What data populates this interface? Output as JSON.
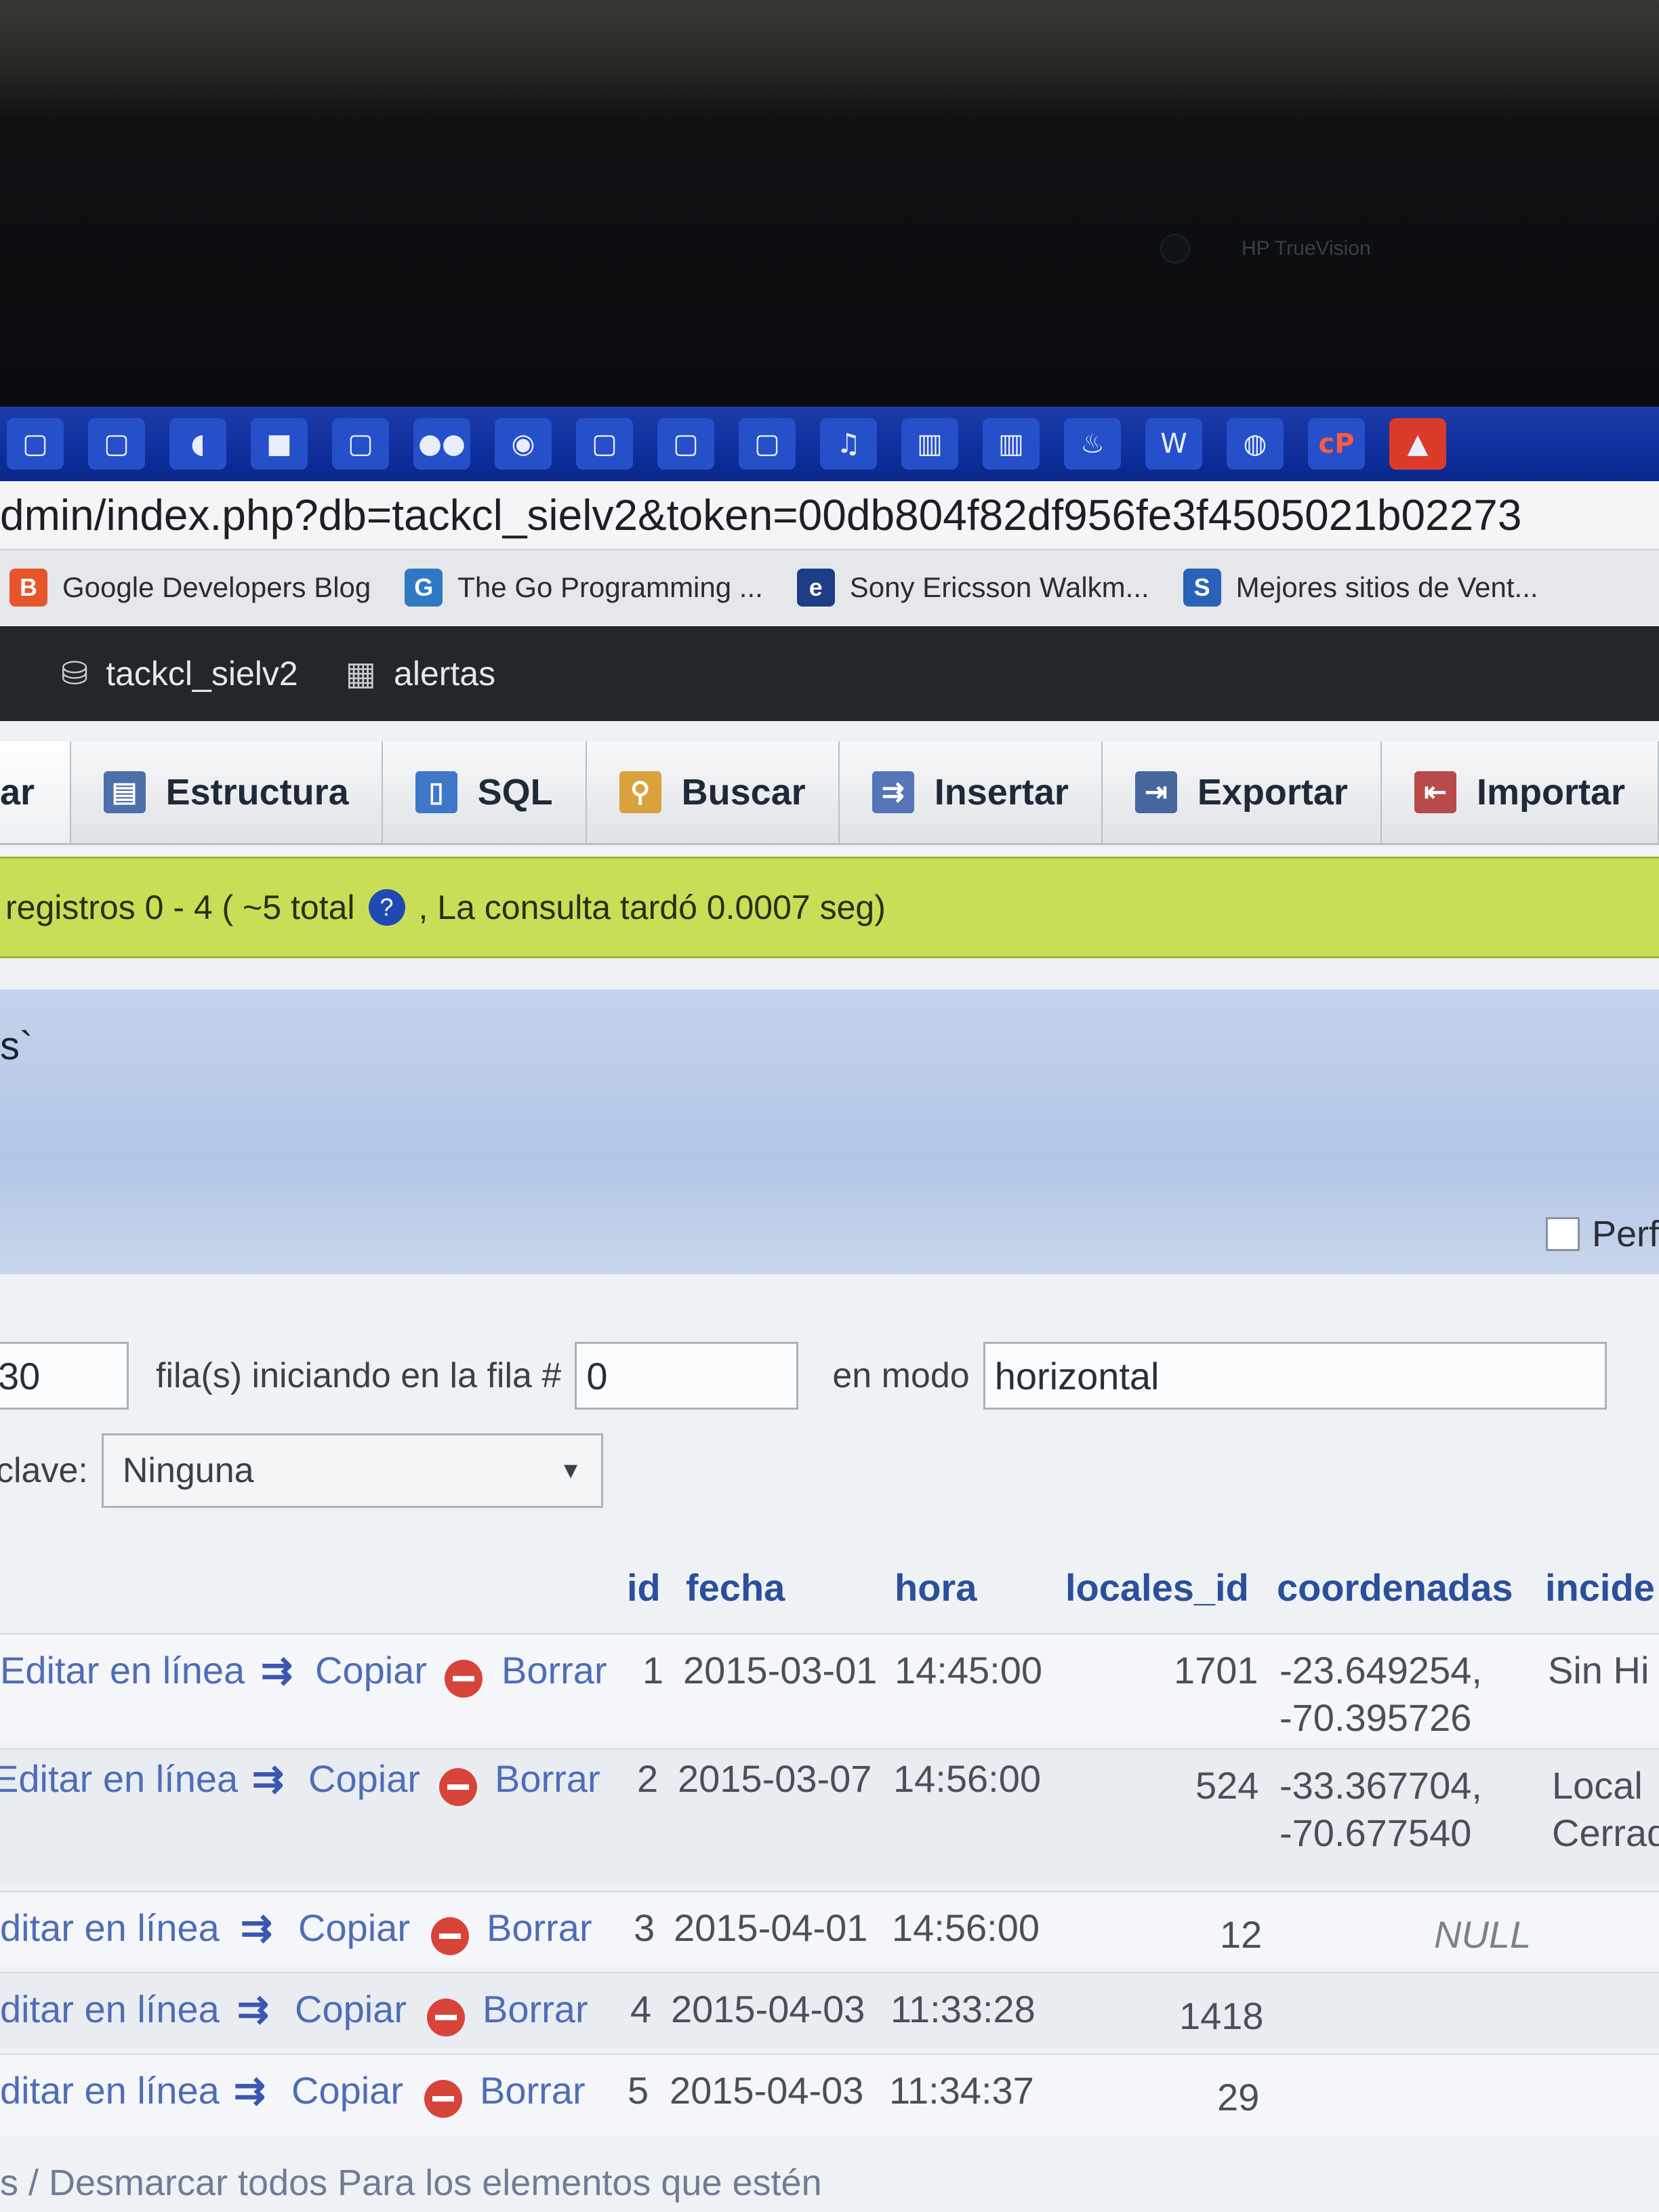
{
  "bezel": {
    "camera_label": "HP TrueVision"
  },
  "taskbar": {
    "icons": [
      "file-icon",
      "file-icon",
      "chat-icon",
      "dark-square-icon",
      "file-icon",
      "people-icon",
      "chrome-icon",
      "file-icon",
      "file-icon",
      "file-icon",
      "music-icon",
      "window-icon",
      "window-icon",
      "flame-icon",
      "w-icon",
      "disk-icon",
      "cp-icon",
      "alert-icon",
      "file-icon"
    ]
  },
  "address_bar": {
    "url": "dmin/index.php?db=tackcl_sielv2&token=00db804f82df956fe3f4505021b02273"
  },
  "bookmarks": [
    {
      "label": "Google Developers Blog",
      "icon": "blogger-icon",
      "color": "#e8552b"
    },
    {
      "label": "The Go Programming ...",
      "icon": "gopher-icon",
      "color": "#2f78c4"
    },
    {
      "label": "Sony Ericsson Walkm...",
      "icon": "e-icon",
      "color": "#1d3d86"
    },
    {
      "label": "Mejores sitios de Vent...",
      "icon": "s-icon",
      "color": "#2a62b8"
    }
  ],
  "breadcrumb": {
    "database": "tackcl_sielv2",
    "table": "alertas"
  },
  "tabs": [
    {
      "label": "ar",
      "icon": ""
    },
    {
      "label": "Estructura",
      "icon": "structure-icon"
    },
    {
      "label": "SQL",
      "icon": "sql-icon"
    },
    {
      "label": "Buscar",
      "icon": "search-icon"
    },
    {
      "label": "Insertar",
      "icon": "insert-icon"
    },
    {
      "label": "Exportar",
      "icon": "export-icon"
    },
    {
      "label": "Importar",
      "icon": "import-icon"
    }
  ],
  "status": {
    "text_before": "registros 0 - 4 ( ~5 total",
    "text_after": ", La consulta tardó 0.0007 seg)"
  },
  "banner": {
    "text": "s`"
  },
  "profile": {
    "label": "Perf"
  },
  "controls": {
    "rows_value": "30",
    "rows_label": "fila(s) iniciando en la fila #",
    "start_value": "0",
    "mode_label": "en modo",
    "mode_value": "horizontal",
    "key_label": "clave:",
    "key_value": "Ninguna"
  },
  "table": {
    "columns": [
      "id",
      "fecha",
      "hora",
      "locales_id",
      "coordenadas",
      "incide"
    ],
    "actions": {
      "edit": "Editar en línea",
      "copy": "Copiar",
      "delete": "Borrar"
    },
    "rows": [
      {
        "edit": "Editar en línea",
        "id": "1",
        "fecha": "2015-03-01",
        "hora": "14:45:00",
        "locales_id": "1701",
        "coord1": "-23.649254,",
        "coord2": "-70.395726",
        "inc1": "Sin Hi",
        "inc2": ""
      },
      {
        "edit": "Editar en línea",
        "id": "2",
        "fecha": "2015-03-07",
        "hora": "14:56:00",
        "locales_id": "524",
        "coord1": "-33.367704,",
        "coord2": "-70.677540",
        "inc1": "Local",
        "inc2": "Cerrad"
      },
      {
        "edit": "ditar en línea",
        "id": "3",
        "fecha": "2015-04-01",
        "hora": "14:56:00",
        "locales_id": "12",
        "coord1": "NULL",
        "coord2": "",
        "inc1": "",
        "inc2": ""
      },
      {
        "edit": "ditar en línea",
        "id": "4",
        "fecha": "2015-04-03",
        "hora": "11:33:28",
        "locales_id": "1418",
        "coord1": "",
        "coord2": "",
        "inc1": "",
        "inc2": ""
      },
      {
        "edit": "ditar en línea",
        "id": "5",
        "fecha": "2015-04-03",
        "hora": "11:34:37",
        "locales_id": "29",
        "coord1": "",
        "coord2": "",
        "inc1": "",
        "inc2": ""
      }
    ]
  },
  "footer": {
    "text": "s / Desmarcar todos  Para los elementos que estén"
  }
}
